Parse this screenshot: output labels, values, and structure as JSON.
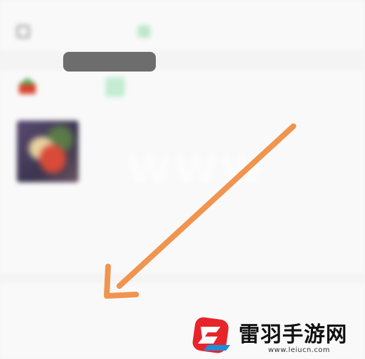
{
  "screen": {
    "top_text": "",
    "row1_text": "",
    "store": {
      "name": "",
      "action": ""
    },
    "product": {
      "name": "",
      "spec": "",
      "price": ""
    },
    "fee": {
      "label": "",
      "value": ""
    },
    "summary": {
      "count": "",
      "total_label": "",
      "total_value": ""
    },
    "section_title": "",
    "bottom_label": "",
    "bottom_value": ""
  },
  "colors": {
    "arrow": "#f0944e",
    "logo_red": "#e8242b",
    "logo_blue": "#1e8ed6",
    "accent_green": "#3fbf6f"
  },
  "watermark": {
    "name": "雷羽手游网",
    "url": "www.leiucn.com"
  }
}
